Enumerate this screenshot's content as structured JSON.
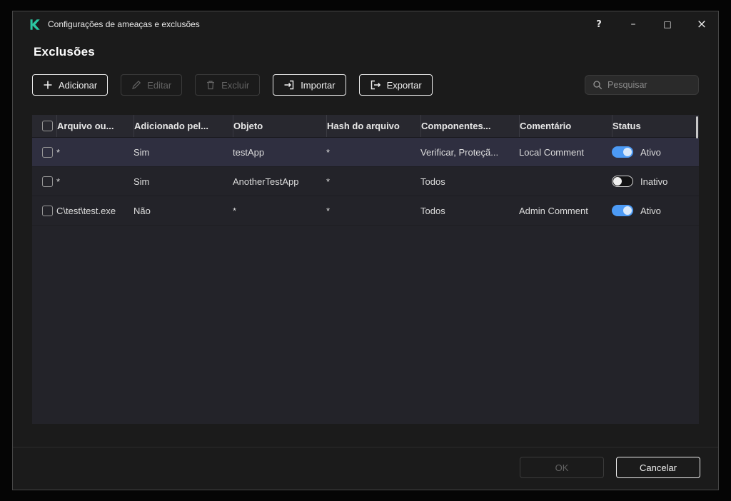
{
  "window": {
    "title": "Configurações de ameaças e exclusões",
    "controls": {
      "help": "?",
      "minimize": "–",
      "maximize": "□",
      "close": "×"
    }
  },
  "page": {
    "title": "Exclusões"
  },
  "toolbar": {
    "add_label": "Adicionar",
    "edit_label": "Editar",
    "delete_label": "Excluir",
    "import_label": "Importar",
    "export_label": "Exportar",
    "search_placeholder": "Pesquisar"
  },
  "table": {
    "columns": [
      "Arquivo ou...",
      "Adicionado pel...",
      "Objeto",
      "Hash do arquivo",
      "Componentes...",
      "Comentário",
      "Status"
    ],
    "rows": [
      {
        "file_or_folder": "*",
        "added_by": "Sim",
        "object": "testApp",
        "file_hash": "*",
        "components": "Verificar, Proteçã...",
        "comment": "Local Comment",
        "status_label": "Ativo",
        "active": true,
        "selected": true
      },
      {
        "file_or_folder": "*",
        "added_by": "Sim",
        "object": "AnotherTestApp",
        "file_hash": "*",
        "components": "Todos",
        "comment": "",
        "status_label": "Inativo",
        "active": false,
        "selected": false
      },
      {
        "file_or_folder": "C\\test\\test.exe",
        "added_by": "Não",
        "object": "*",
        "file_hash": "*",
        "components": "Todos",
        "comment": "Admin Comment",
        "status_label": "Ativo",
        "active": true,
        "selected": false
      }
    ]
  },
  "footer": {
    "ok_label": "OK",
    "cancel_label": "Cancelar"
  },
  "colors": {
    "brand_green": "#2BC8A2",
    "toggle_active_blue": "#4C9AF5",
    "selected_row": "#2F2F40",
    "window_background": "#1B1B1B",
    "table_background": "#232329"
  }
}
